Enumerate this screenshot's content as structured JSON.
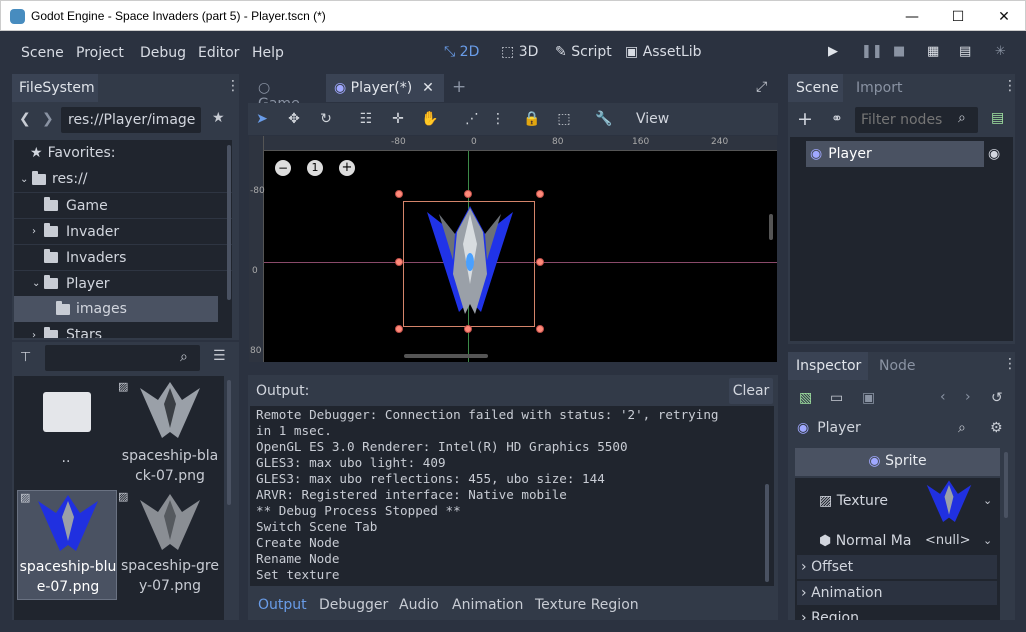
{
  "window": {
    "title": "Godot Engine - Space Invaders (part 5) - Player.tscn (*)",
    "minimize": "—",
    "maximize": "☐",
    "close": "✕"
  },
  "menu": {
    "items": [
      "Scene",
      "Project",
      "Debug",
      "Editor",
      "Help"
    ]
  },
  "workspaces": {
    "w2d": "2D",
    "w3d": "3D",
    "script": "Script",
    "assetlib": "AssetLib"
  },
  "filesystem": {
    "tab": "FileSystem",
    "path": "res://Player/image",
    "favorites": "Favorites:",
    "tree": [
      "res://",
      "Game",
      "Invader",
      "Invaders",
      "Player",
      "images",
      "Stars"
    ],
    "search_placeholder": "",
    "files": [
      {
        "name": ".."
      },
      {
        "name": "spaceship-black-07.png"
      },
      {
        "name": "spaceship-blue-07.png"
      },
      {
        "name": "spaceship-grey-07.png"
      }
    ]
  },
  "editor_tabs": {
    "game": "Game",
    "player": "Player(*)"
  },
  "viewport": {
    "view_menu": "View",
    "ruler_labels": [
      "-80",
      "0",
      "80",
      "160",
      "240"
    ],
    "vruler_labels": [
      "-80",
      "0",
      "80"
    ],
    "zoom_reset": "1"
  },
  "output": {
    "title": "Output:",
    "clear": "Clear",
    "lines": [
      "Remote Debugger: Connection failed with status: '2', retrying",
      "in 1 msec.",
      "OpenGL ES 3.0 Renderer: Intel(R) HD Graphics 5500",
      "GLES3: max ubo light: 409",
      "GLES3: max ubo reflections: 455, ubo size: 144",
      "ARVR: Registered interface: Native mobile",
      "** Debug Process Stopped **",
      "Switch Scene Tab",
      "Create Node",
      "Rename Node",
      "Set texture"
    ],
    "tabs": [
      "Output",
      "Debugger",
      "Audio",
      "Animation",
      "Texture Region"
    ]
  },
  "scene": {
    "tab": "Scene",
    "tab2": "Import",
    "filter_placeholder": "Filter nodes",
    "root": "Player"
  },
  "inspector": {
    "tab": "Inspector",
    "tab2": "Node",
    "object": "Player",
    "class": "Sprite",
    "texture_label": "Texture",
    "normal_label": "Normal Ma",
    "normal_value": "<null>",
    "sections": [
      "Offset",
      "Animation",
      "Region"
    ]
  },
  "colors": {
    "accent": "#699ce8",
    "bg": "#2b3240",
    "panel": "#323a48"
  }
}
